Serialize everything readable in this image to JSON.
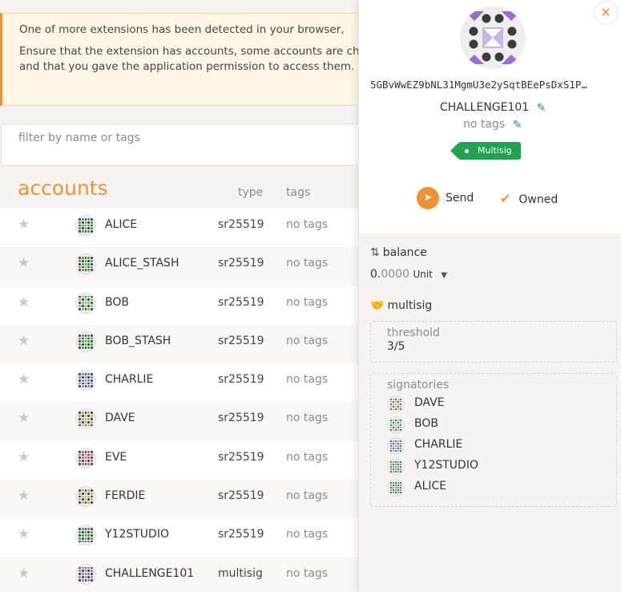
{
  "banner": {
    "line1": "One of more extensions has been detected in your browser,",
    "line2": "Ensure that the extension has accounts, some accounts are chain and that you gave the application permission to access them."
  },
  "filter": {
    "placeholder": "filter by name or tags"
  },
  "table": {
    "title": "accounts",
    "col_type": "type",
    "col_tags": "tags",
    "rows": [
      {
        "name": "ALICE",
        "type": "sr25519",
        "tags": "no tags",
        "color": "#3aa13a"
      },
      {
        "name": "ALICE_STASH",
        "type": "sr25519",
        "tags": "no tags",
        "color": "#3aa13a"
      },
      {
        "name": "BOB",
        "type": "sr25519",
        "tags": "no tags",
        "color": "#6bc36b"
      },
      {
        "name": "BOB_STASH",
        "type": "sr25519",
        "tags": "no tags",
        "color": "#3aa13a"
      },
      {
        "name": "CHARLIE",
        "type": "sr25519",
        "tags": "no tags",
        "color": "#5b8fd0"
      },
      {
        "name": "DAVE",
        "type": "sr25519",
        "tags": "no tags",
        "color": "#c4a64a"
      },
      {
        "name": "EVE",
        "type": "sr25519",
        "tags": "no tags",
        "color": "#d05b5b"
      },
      {
        "name": "FERDIE",
        "type": "sr25519",
        "tags": "no tags",
        "color": "#c4a64a"
      },
      {
        "name": "Y12STUDIO",
        "type": "sr25519",
        "tags": "no tags",
        "color": "#3aa13a"
      },
      {
        "name": "CHALLENGE101",
        "type": "multisig",
        "tags": "no tags",
        "color": "#9b6bd0"
      }
    ]
  },
  "sidebar": {
    "close_icon": "close-icon",
    "address": "5GBvWwEZ9bNL31MgmU3e2ySqtBEePsDxS1P…",
    "name": "CHALLENGE101",
    "tags_label": "no tags",
    "tag_badge": "Multisig",
    "send_label": "Send",
    "owned_label": "Owned",
    "balance_header": "balance",
    "balance_int": "0.",
    "balance_dec": "0000",
    "balance_unit": "Unit",
    "multisig_header": "multisig",
    "threshold_label": "threshold",
    "threshold_value": "3/5",
    "signatories_label": "signatories",
    "signatories": [
      {
        "name": "DAVE",
        "color": "#c4a64a"
      },
      {
        "name": "BOB",
        "color": "#6bc36b"
      },
      {
        "name": "CHARLIE",
        "color": "#5b8fd0"
      },
      {
        "name": "Y12STUDIO",
        "color": "#3aa13a"
      },
      {
        "name": "ALICE",
        "color": "#3aa13a"
      }
    ]
  },
  "colors": {
    "accent": "#f19135",
    "multisig_tag": "#21a151",
    "edit_icon": "#2e86c1"
  }
}
